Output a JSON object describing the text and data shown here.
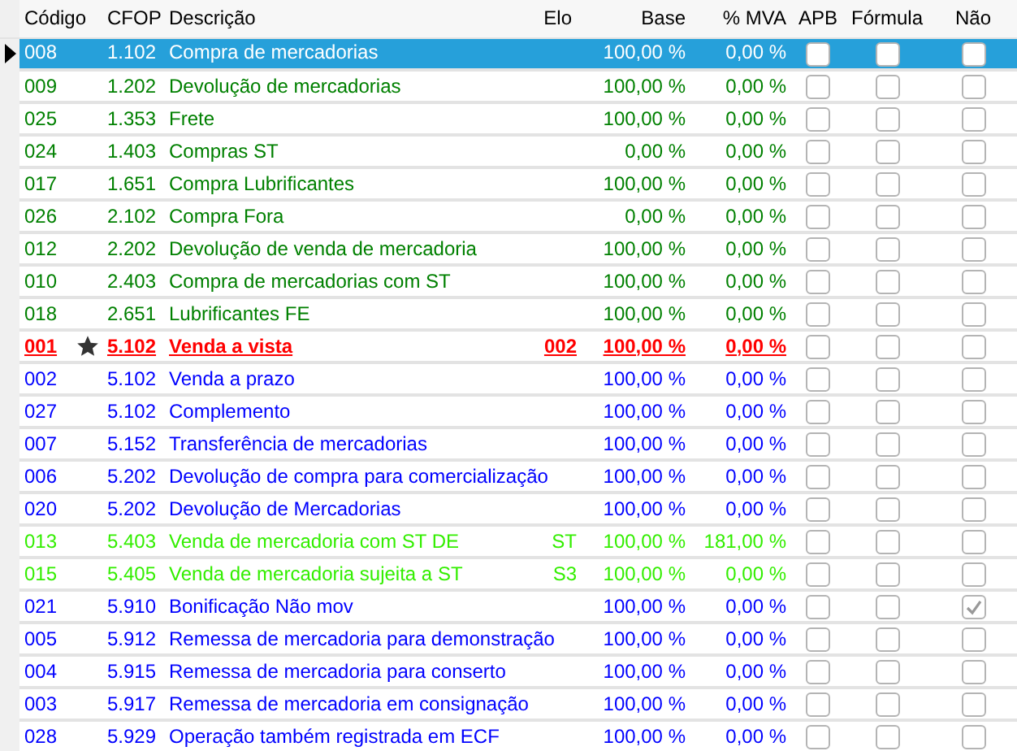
{
  "columns": [
    "Código",
    "CFOP",
    "Descrição",
    "Elo",
    "Base",
    "% MVA",
    "APB",
    "Fórmula",
    "Não"
  ],
  "rows": [
    {
      "code": "008",
      "cfop": "1.102",
      "description": "Compra de mercadorias",
      "elo": "",
      "base": "100,00 %",
      "mva": "0,00 %",
      "color": "#ffffff",
      "selected": true,
      "starred": false,
      "emphasis": false,
      "apb": false,
      "formula": false,
      "nao": false
    },
    {
      "code": "009",
      "cfop": "1.202",
      "description": "Devolução de mercadorias",
      "base": "100,00 %",
      "mva": "0,00 %",
      "color": "#008000",
      "selected": false,
      "starred": false,
      "emphasis": false,
      "apb": false,
      "formula": false,
      "nao": false
    },
    {
      "code": "025",
      "cfop": "1.353",
      "description": "Frete",
      "base": "100,00 %",
      "mva": "0,00 %",
      "color": "#008000",
      "selected": false,
      "starred": false,
      "emphasis": false,
      "apb": false,
      "formula": false,
      "nao": false
    },
    {
      "code": "024",
      "cfop": "1.403",
      "description": "Compras ST",
      "base": "0,00 %",
      "mva": "0,00 %",
      "color": "#008000",
      "selected": false,
      "starred": false,
      "emphasis": false,
      "apb": false,
      "formula": false,
      "nao": false
    },
    {
      "code": "017",
      "cfop": "1.651",
      "description": "Compra Lubrificantes",
      "base": "100,00 %",
      "mva": "0,00 %",
      "color": "#008000",
      "selected": false,
      "starred": false,
      "emphasis": false,
      "apb": false,
      "formula": false,
      "nao": false
    },
    {
      "code": "026",
      "cfop": "2.102",
      "description": "Compra Fora",
      "base": "0,00 %",
      "mva": "0,00 %",
      "color": "#008000",
      "selected": false,
      "starred": false,
      "emphasis": false,
      "apb": false,
      "formula": false,
      "nao": false
    },
    {
      "code": "012",
      "cfop": "2.202",
      "description": "Devolução de venda de mercadoria",
      "base": "100,00 %",
      "mva": "0,00 %",
      "color": "#008000",
      "selected": false,
      "starred": false,
      "emphasis": false,
      "apb": false,
      "formula": false,
      "nao": false
    },
    {
      "code": "010",
      "cfop": "2.403",
      "description": "Compra de mercadorias com ST",
      "base": "100,00 %",
      "mva": "0,00 %",
      "color": "#008000",
      "selected": false,
      "starred": false,
      "emphasis": false,
      "apb": false,
      "formula": false,
      "nao": false
    },
    {
      "code": "018",
      "cfop": "2.651",
      "description": "Lubrificantes FE",
      "base": "100,00 %",
      "mva": "0,00 %",
      "color": "#008000",
      "selected": false,
      "starred": false,
      "emphasis": false,
      "apb": false,
      "formula": false,
      "nao": false
    },
    {
      "code": "001",
      "cfop": "5.102",
      "description": "Venda a vista",
      "elo": "002",
      "base": "100,00 %",
      "mva": "0,00 %",
      "color": "#ff0000",
      "selected": false,
      "starred": true,
      "emphasis": true,
      "apb": false,
      "formula": false,
      "nao": false
    },
    {
      "code": "002",
      "cfop": "5.102",
      "description": "Venda a prazo",
      "base": "100,00 %",
      "mva": "0,00 %",
      "color": "#0000ff",
      "selected": false,
      "starred": false,
      "emphasis": false,
      "apb": false,
      "formula": false,
      "nao": false
    },
    {
      "code": "027",
      "cfop": "5.102",
      "description": "Complemento",
      "base": "100,00 %",
      "mva": "0,00 %",
      "color": "#0000ff",
      "selected": false,
      "starred": false,
      "emphasis": false,
      "apb": false,
      "formula": false,
      "nao": false
    },
    {
      "code": "007",
      "cfop": "5.152",
      "description": "Transferência de mercadorias",
      "base": "100,00 %",
      "mva": "0,00 %",
      "color": "#0000ff",
      "selected": false,
      "starred": false,
      "emphasis": false,
      "apb": false,
      "formula": false,
      "nao": false
    },
    {
      "code": "006",
      "cfop": "5.202",
      "description": "Devolução de compra para comercialização",
      "base": "100,00 %",
      "mva": "0,00 %",
      "color": "#0000ff",
      "selected": false,
      "starred": false,
      "emphasis": false,
      "apb": false,
      "formula": false,
      "nao": false
    },
    {
      "code": "020",
      "cfop": "5.202",
      "description": "Devolução de Mercadorias",
      "base": "100,00 %",
      "mva": "0,00 %",
      "color": "#0000ff",
      "selected": false,
      "starred": false,
      "emphasis": false,
      "apb": false,
      "formula": false,
      "nao": false
    },
    {
      "code": "013",
      "cfop": "5.403",
      "description": "Venda de mercadoria com ST DE",
      "elo": "ST",
      "base": "100,00 %",
      "mva": "181,00 %",
      "color": "#33ee00",
      "selected": false,
      "starred": false,
      "emphasis": false,
      "apb": false,
      "formula": false,
      "nao": false
    },
    {
      "code": "015",
      "cfop": "5.405",
      "description": "Venda de mercadoria sujeita a ST",
      "elo": "S3",
      "base": "100,00 %",
      "mva": "0,00 %",
      "color": "#33ee00",
      "selected": false,
      "starred": false,
      "emphasis": false,
      "apb": false,
      "formula": false,
      "nao": false
    },
    {
      "code": "021",
      "cfop": "5.910",
      "description": "Bonificação Não mov",
      "base": "100,00 %",
      "mva": "0,00 %",
      "color": "#0000ff",
      "selected": false,
      "starred": false,
      "emphasis": false,
      "apb": false,
      "formula": false,
      "nao": true
    },
    {
      "code": "005",
      "cfop": "5.912",
      "description": "Remessa de mercadoria para demonstração",
      "base": "100,00 %",
      "mva": "0,00 %",
      "color": "#0000ff",
      "selected": false,
      "starred": false,
      "emphasis": false,
      "apb": false,
      "formula": false,
      "nao": false
    },
    {
      "code": "004",
      "cfop": "5.915",
      "description": "Remessa de mercadoria para conserto",
      "base": "100,00 %",
      "mva": "0,00 %",
      "color": "#0000ff",
      "selected": false,
      "starred": false,
      "emphasis": false,
      "apb": false,
      "formula": false,
      "nao": false
    },
    {
      "code": "003",
      "cfop": "5.917",
      "description": "Remessa de mercadoria em consignação",
      "base": "100,00 %",
      "mva": "0,00 %",
      "color": "#0000ff",
      "selected": false,
      "starred": false,
      "emphasis": false,
      "apb": false,
      "formula": false,
      "nao": false
    },
    {
      "code": "028",
      "cfop": "5.929",
      "description": "Operação também registrada em ECF",
      "base": "100,00 %",
      "mva": "0,00 %",
      "color": "#0000ff",
      "selected": false,
      "starred": false,
      "emphasis": false,
      "apb": false,
      "formula": false,
      "nao": false
    }
  ]
}
